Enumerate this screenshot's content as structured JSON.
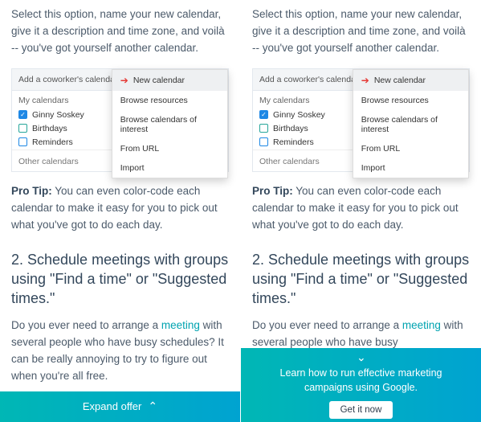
{
  "intro": "Select this option, name your new calendar, give it a description and time zone, and voilà -- you've got yourself another calendar.",
  "calendar": {
    "add_placeholder": "Add a coworker's calendar",
    "my_label": "My calendars",
    "items": [
      {
        "label": "Ginny Soskey",
        "checked": true,
        "color": "#1e88e5"
      },
      {
        "label": "Birthdays",
        "checked": false,
        "color": "#26a69a"
      },
      {
        "label": "Reminders",
        "checked": false,
        "color": "#1e88e5"
      }
    ],
    "other_label": "Other calendars",
    "menu": [
      "New calendar",
      "Browse resources",
      "Browse calendars of interest",
      "From URL",
      "Import"
    ]
  },
  "protip_label": "Pro Tip:",
  "protip_rest": " You can even color-code each calendar to make it easy for you to pick out what you've got to do each day.",
  "heading": "2. Schedule meetings with groups using \"Find a time\" or \"Suggested times.\"",
  "para2a": "Do you ever need to arrange a ",
  "para2link": "meeting",
  "para2b": " with several people who have busy schedules? It can be really annoying to try to figure out when you're all free.",
  "para2b_short": " with several people who have busy",
  "left_banner": {
    "label": "Expand offer"
  },
  "right_banner": {
    "msg": "Learn how to run effective marketing campaigns using Google.",
    "cta": "Get it now"
  }
}
